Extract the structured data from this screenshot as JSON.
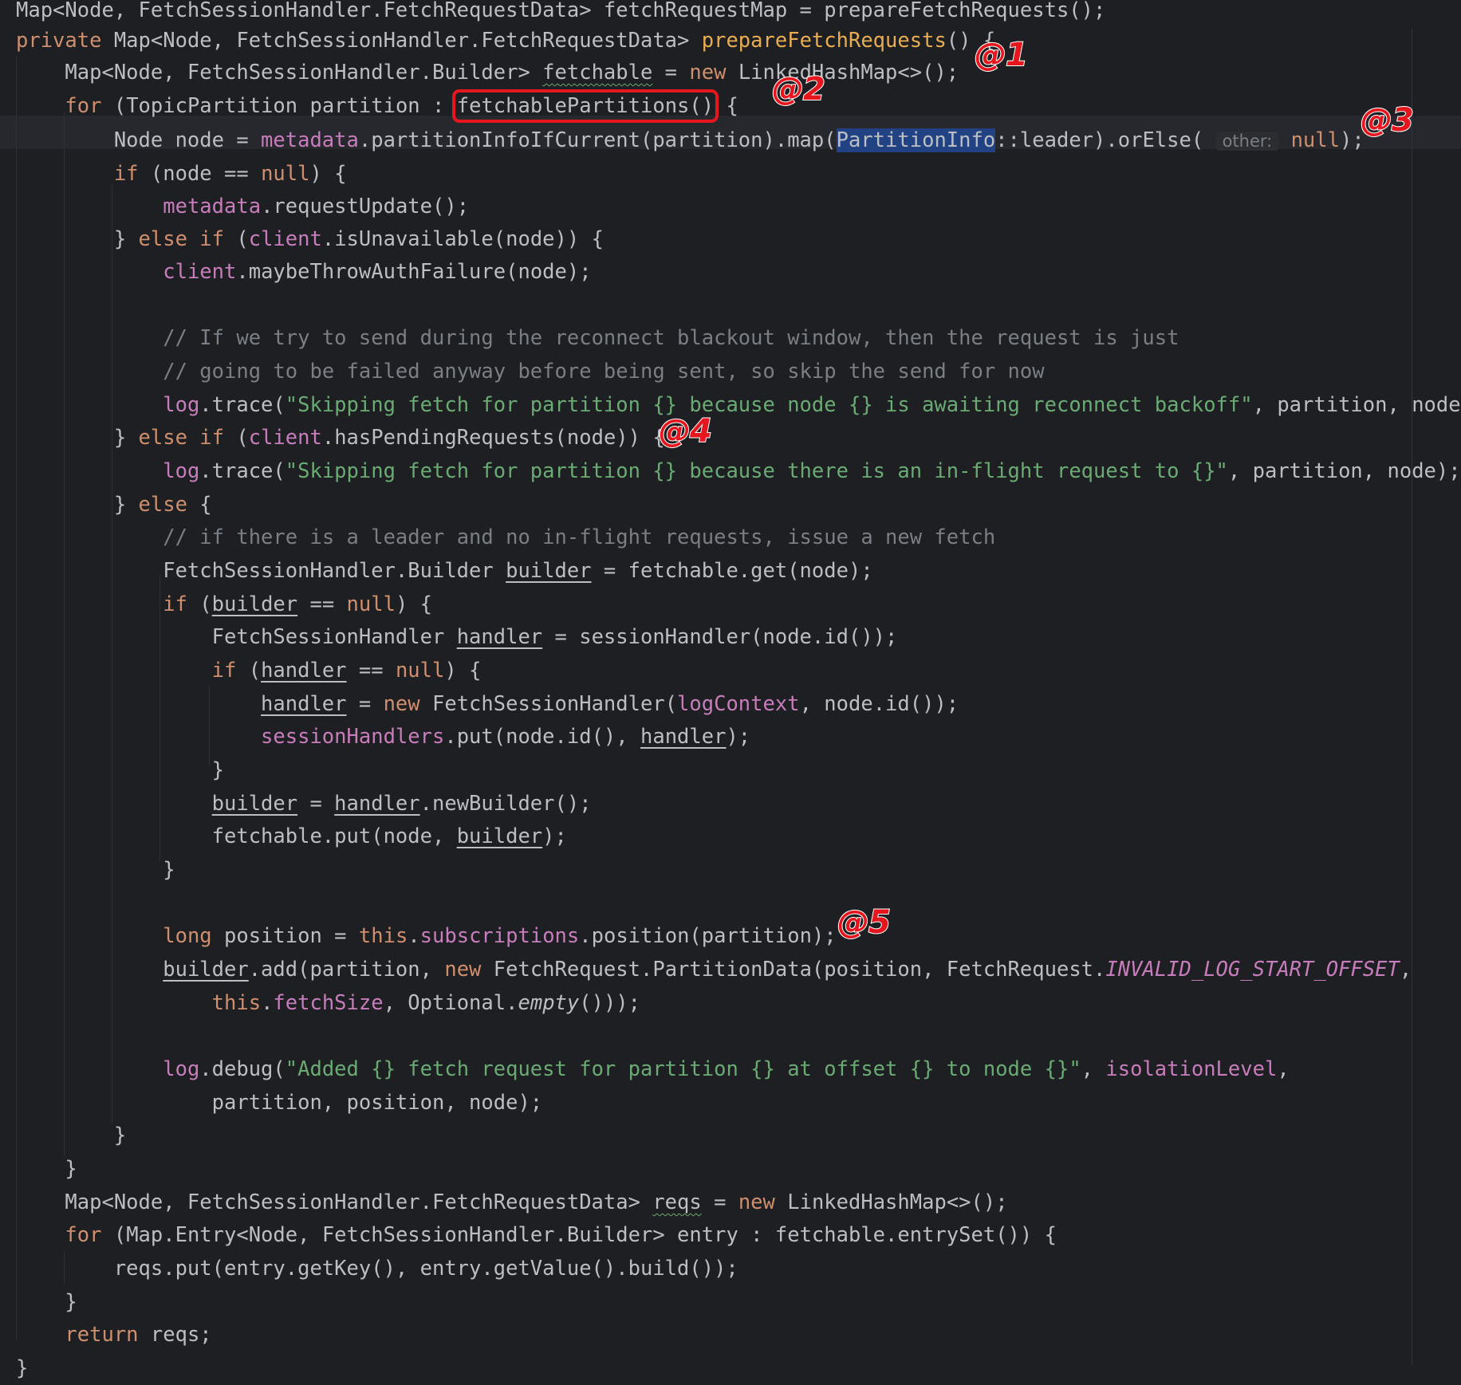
{
  "code_lines": [
    [
      {
        "t": "Map<Node, FetchSessionHandler.FetchRequestData> fetchRequestMap = prepareFetchRequests();"
      }
    ],
    [
      {
        "t": "private ",
        "c": "kw"
      },
      {
        "t": "Map<Node, FetchSessionHandler.FetchRequestData> "
      },
      {
        "t": "prepareFetchRequests",
        "c": "mdecl"
      },
      {
        "t": "() {"
      }
    ],
    [
      {
        "t": "    Map<Node, FetchSessionHandler.Builder> "
      },
      {
        "t": "fetchable",
        "c": "wavy"
      },
      {
        "t": " = "
      },
      {
        "t": "new ",
        "c": "kw"
      },
      {
        "t": "LinkedHashMap<>();"
      }
    ],
    [
      {
        "t": "    "
      },
      {
        "t": "for ",
        "c": "kw"
      },
      {
        "t": "(TopicPartition partition : "
      },
      {
        "t": "fetchablePartitions()",
        "c": "box"
      },
      {
        "t": " {"
      }
    ],
    [
      {
        "t": "        Node node = "
      },
      {
        "t": "metadata",
        "c": "fld"
      },
      {
        "t": ".partitionInfoIfCurrent(partition).map("
      },
      {
        "t": "PartitionInfo",
        "c": "sel"
      },
      {
        "t": "::leader).orElse( "
      },
      {
        "t": "other:",
        "c": "hint"
      },
      {
        "t": " "
      },
      {
        "t": "null",
        "c": "kw"
      },
      {
        "t": ");"
      }
    ],
    [
      {
        "t": "        "
      },
      {
        "t": "if ",
        "c": "kw"
      },
      {
        "t": "(node == "
      },
      {
        "t": "null",
        "c": "kw"
      },
      {
        "t": ") {"
      }
    ],
    [
      {
        "t": "            "
      },
      {
        "t": "metadata",
        "c": "fld"
      },
      {
        "t": ".requestUpdate();"
      }
    ],
    [
      {
        "t": "        } "
      },
      {
        "t": "else if ",
        "c": "kw"
      },
      {
        "t": "("
      },
      {
        "t": "client",
        "c": "fld"
      },
      {
        "t": ".isUnavailable(node)) {"
      }
    ],
    [
      {
        "t": "            "
      },
      {
        "t": "client",
        "c": "fld"
      },
      {
        "t": ".maybeThrowAuthFailure(node);"
      }
    ],
    [
      {
        "t": ""
      }
    ],
    [
      {
        "t": "            "
      },
      {
        "t": "// If we try to send during the reconnect blackout window, then the request is just",
        "c": "cmt"
      }
    ],
    [
      {
        "t": "            "
      },
      {
        "t": "// going to be failed anyway before being sent, so skip the send for now",
        "c": "cmt"
      }
    ],
    [
      {
        "t": "            "
      },
      {
        "t": "log",
        "c": "fld"
      },
      {
        "t": ".trace("
      },
      {
        "t": "\"Skipping fetch for partition {} because node {} is awaiting reconnect backoff\"",
        "c": "str"
      },
      {
        "t": ", partition, node);"
      }
    ],
    [
      {
        "t": "        } "
      },
      {
        "t": "else if ",
        "c": "kw"
      },
      {
        "t": "("
      },
      {
        "t": "client",
        "c": "fld"
      },
      {
        "t": ".hasPendingRequests(node)) {"
      }
    ],
    [
      {
        "t": "            "
      },
      {
        "t": "log",
        "c": "fld"
      },
      {
        "t": ".trace("
      },
      {
        "t": "\"Skipping fetch for partition {} because there is an in-flight request to {}\"",
        "c": "str"
      },
      {
        "t": ", partition, node);"
      }
    ],
    [
      {
        "t": "        } "
      },
      {
        "t": "else ",
        "c": "kw"
      },
      {
        "t": "{"
      }
    ],
    [
      {
        "t": "            "
      },
      {
        "t": "// if there is a leader and no in-flight requests, issue a new fetch",
        "c": "cmt"
      }
    ],
    [
      {
        "t": "            FetchSessionHandler.Builder "
      },
      {
        "t": "builder",
        "c": "ul"
      },
      {
        "t": " = fetchable.get(node);"
      }
    ],
    [
      {
        "t": "            "
      },
      {
        "t": "if ",
        "c": "kw"
      },
      {
        "t": "("
      },
      {
        "t": "builder",
        "c": "ul"
      },
      {
        "t": " == "
      },
      {
        "t": "null",
        "c": "kw"
      },
      {
        "t": ") {"
      }
    ],
    [
      {
        "t": "                FetchSessionHandler "
      },
      {
        "t": "handler",
        "c": "ul"
      },
      {
        "t": " = sessionHandler(node.id());"
      }
    ],
    [
      {
        "t": "                "
      },
      {
        "t": "if ",
        "c": "kw"
      },
      {
        "t": "("
      },
      {
        "t": "handler",
        "c": "ul"
      },
      {
        "t": " == "
      },
      {
        "t": "null",
        "c": "kw"
      },
      {
        "t": ") {"
      }
    ],
    [
      {
        "t": "                    "
      },
      {
        "t": "handler",
        "c": "ul"
      },
      {
        "t": " = "
      },
      {
        "t": "new ",
        "c": "kw"
      },
      {
        "t": "FetchSessionHandler("
      },
      {
        "t": "logContext",
        "c": "fld"
      },
      {
        "t": ", node.id());"
      }
    ],
    [
      {
        "t": "                    "
      },
      {
        "t": "sessionHandlers",
        "c": "fld"
      },
      {
        "t": ".put(node.id(), "
      },
      {
        "t": "handler",
        "c": "ul"
      },
      {
        "t": ");"
      }
    ],
    [
      {
        "t": "                }"
      }
    ],
    [
      {
        "t": "                "
      },
      {
        "t": "builder",
        "c": "ul"
      },
      {
        "t": " = "
      },
      {
        "t": "handler",
        "c": "ul"
      },
      {
        "t": ".newBuilder();"
      }
    ],
    [
      {
        "t": "                fetchable.put(node, "
      },
      {
        "t": "builder",
        "c": "ul"
      },
      {
        "t": ");"
      }
    ],
    [
      {
        "t": "            }"
      }
    ],
    [
      {
        "t": ""
      }
    ],
    [
      {
        "t": "            "
      },
      {
        "t": "long ",
        "c": "kw"
      },
      {
        "t": "position = "
      },
      {
        "t": "this",
        "c": "kw"
      },
      {
        "t": "."
      },
      {
        "t": "subscriptions",
        "c": "fld"
      },
      {
        "t": ".position(partition);"
      }
    ],
    [
      {
        "t": "            "
      },
      {
        "t": "builder",
        "c": "ul"
      },
      {
        "t": ".add(partition, "
      },
      {
        "t": "new ",
        "c": "kw"
      },
      {
        "t": "FetchRequest.PartitionData(position, FetchRequest."
      },
      {
        "t": "INVALID_LOG_START_OFFSET",
        "c": "const"
      },
      {
        "t": ","
      }
    ],
    [
      {
        "t": "                "
      },
      {
        "t": "this",
        "c": "kw"
      },
      {
        "t": "."
      },
      {
        "t": "fetchSize",
        "c": "fld"
      },
      {
        "t": ", Optional."
      },
      {
        "t": "empty",
        "c": "it"
      },
      {
        "t": "()));"
      }
    ],
    [
      {
        "t": ""
      }
    ],
    [
      {
        "t": "            "
      },
      {
        "t": "log",
        "c": "fld"
      },
      {
        "t": ".debug("
      },
      {
        "t": "\"Added {} fetch request for partition {} at offset {} to node {}\"",
        "c": "str"
      },
      {
        "t": ", "
      },
      {
        "t": "isolationLevel",
        "c": "fld"
      },
      {
        "t": ","
      }
    ],
    [
      {
        "t": "                partition, position, node);"
      }
    ],
    [
      {
        "t": "        }"
      }
    ],
    [
      {
        "t": "    }"
      }
    ],
    [
      {
        "t": "    Map<Node, FetchSessionHandler.FetchRequestData> "
      },
      {
        "t": "reqs",
        "c": "wavy"
      },
      {
        "t": " = "
      },
      {
        "t": "new ",
        "c": "kw"
      },
      {
        "t": "LinkedHashMap<>();"
      }
    ],
    [
      {
        "t": "    "
      },
      {
        "t": "for ",
        "c": "kw"
      },
      {
        "t": "(Map.Entry<Node, FetchSessionHandler.Builder> entry : fetchable.entrySet()) {"
      }
    ],
    [
      {
        "t": "        reqs.put(entry.getKey(), entry.getValue().build());"
      }
    ],
    [
      {
        "t": "    }"
      }
    ],
    [
      {
        "t": "    "
      },
      {
        "t": "return ",
        "c": "kw"
      },
      {
        "t": "reqs;"
      }
    ],
    [
      {
        "t": "}"
      }
    ]
  ],
  "annotations": [
    "@1",
    "@2",
    "@3",
    "@4",
    "@5"
  ]
}
